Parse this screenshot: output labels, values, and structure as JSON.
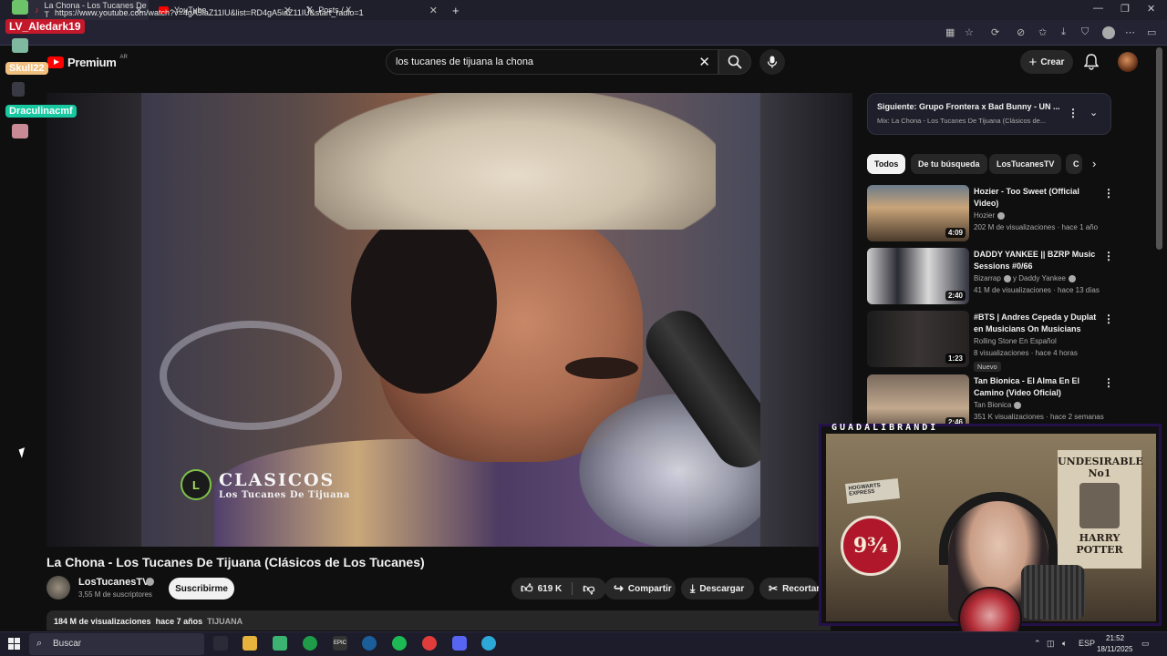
{
  "browser": {
    "tabs": [
      {
        "label": "La Chona - Los Tucanes De T",
        "active": true
      },
      {
        "label": "YouTube",
        "active": false
      },
      {
        "label": "Posts / X",
        "active": false
      }
    ],
    "url": "https://www.youtube.com/watch?v=4gA5iaZ11IU&list=RD4gA5iaZ11IU&start_radio=1"
  },
  "youtube": {
    "logo_text": "Premium",
    "logo_country": "AR",
    "search_value": "los tucanes de tijuana la chona",
    "create_label": "Crear"
  },
  "video": {
    "overlay_title": "CLASICOS",
    "overlay_subtitle": "Los Tucanes De Tijuana",
    "title": "La Chona - Los Tucanes De Tijuana (Clásicos de Los Tucanes)",
    "channel": "LosTucanesTV",
    "subscribers": "3,55 M de suscriptores",
    "subscribe_label": "Suscribirme",
    "likes": "619 K",
    "share_label": "Compartir",
    "download_label": "Descargar",
    "clip_label": "Recortar",
    "views": "184 M de visualizaciones",
    "age": "hace 7 años",
    "tag": "TIJUANA"
  },
  "up_next": {
    "title": "Siguiente: Grupo Frontera x Bad Bunny - UN ...",
    "subtitle": "Mix: La Chona - Los Tucanes De Tijuana (Clásicos de..."
  },
  "chips": [
    "Todos",
    "De tu búsqueda",
    "LosTucanesTV",
    "C"
  ],
  "recommendations": [
    {
      "title": "Hozier - Too Sweet (Official Video)",
      "channel": "Hozier",
      "meta": "202 M de visualizaciones · hace 1 año",
      "duration": "4:09",
      "badge": ""
    },
    {
      "title": "DADDY YANKEE || BZRP Music Sessions #0/66",
      "channel": "Bizarrap",
      "channel2": "y Daddy Yankee",
      "meta": "41 M de visualizaciones · hace 13 días",
      "duration": "2:40",
      "badge": ""
    },
    {
      "title": "#BTS | Andres Cepeda y Duplat en Musicians On Musicians",
      "channel": "Rolling Stone En Español",
      "meta": "8 visualizaciones · hace 4 horas",
      "duration": "1:23",
      "badge": "Nuevo"
    },
    {
      "title": "Tan Bionica - El Alma En El Camino (Video Oficial)",
      "channel": "Tan Bionica",
      "meta": "351 K visualizaciones · hace 2 semanas",
      "duration": "2:46",
      "badge": ""
    }
  ],
  "stream": {
    "webcam_label": "GUADALIBRANDI",
    "chat_users": [
      "LV_Aledark19",
      "Skull22",
      "Draculinacmf"
    ],
    "poster_text": "HOGWARTS EXPRESS",
    "platform_text": "9¾",
    "hp_poster_title": "UNDESIRABLE",
    "hp_poster_no": "No1",
    "hp_poster_name": "HARRY POTTER"
  },
  "taskbar": {
    "search_placeholder": "Buscar",
    "lang": "ESP",
    "time": "21:52",
    "date": "18/11/2025"
  }
}
